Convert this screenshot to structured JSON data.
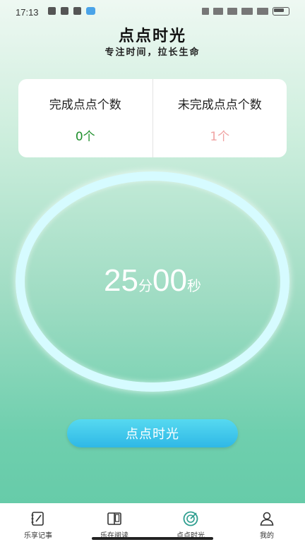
{
  "status_bar": {
    "time": "17:13"
  },
  "header": {
    "title": "点点时光",
    "subtitle": "专注时间，拉长生命"
  },
  "stats": {
    "completed_label": "完成点点个数",
    "completed_value": "0个",
    "uncompleted_label": "未完成点点个数",
    "uncompleted_value": "1个"
  },
  "timer": {
    "minutes": "25",
    "minutes_unit": "分",
    "seconds": "00",
    "seconds_unit": "秒"
  },
  "start_button": {
    "label": "点点时光"
  },
  "tabs": [
    {
      "label": "乐享记事",
      "icon": "notebook-icon"
    },
    {
      "label": "乐在阅读",
      "icon": "book-icon"
    },
    {
      "label": "点点时光",
      "icon": "timer-disc-icon",
      "active": true
    },
    {
      "label": "我的",
      "icon": "user-icon"
    }
  ],
  "colors": {
    "accent": "#2fb8e6",
    "completed": "#1f8f2c",
    "uncompleted": "#f0a3a3"
  }
}
